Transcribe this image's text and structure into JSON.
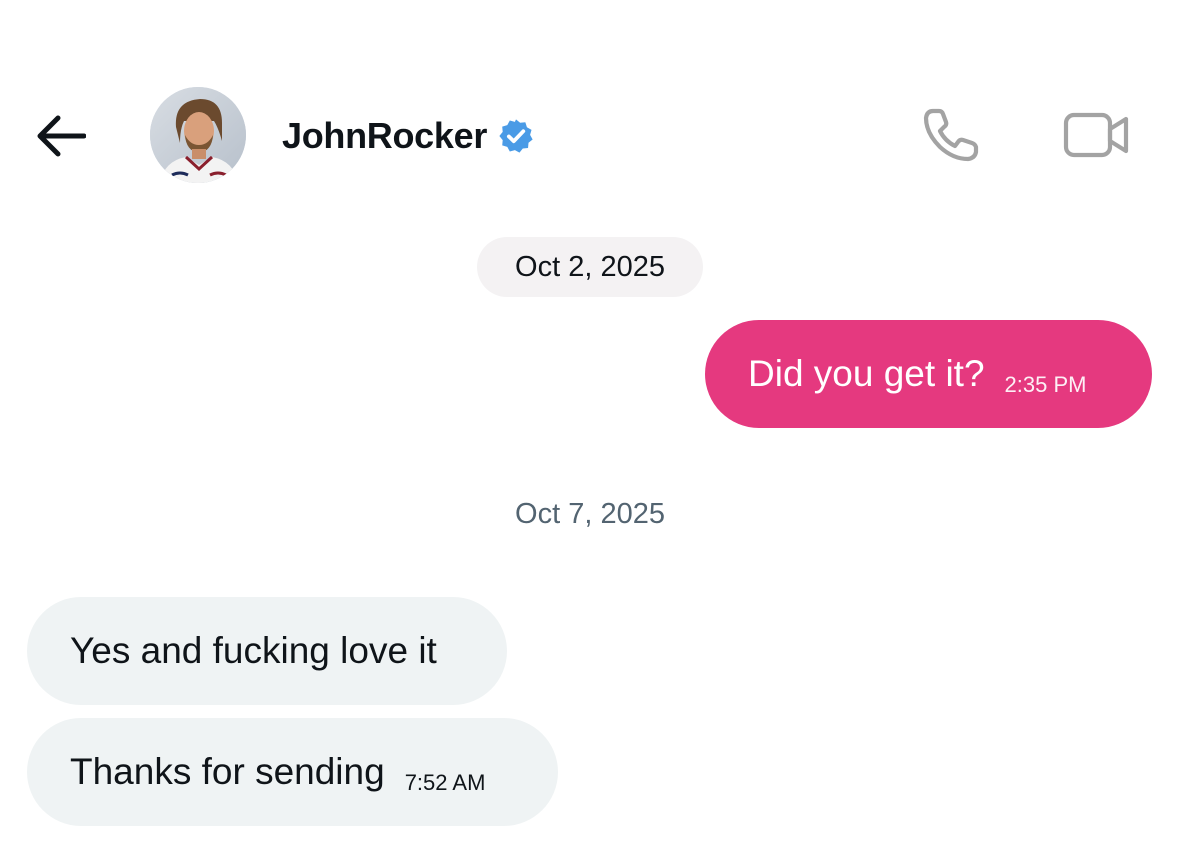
{
  "header": {
    "back_icon": "arrow-left-icon",
    "contact_name": "JohnRocker",
    "verified_badge_icon": "verified-badge-icon",
    "verified_color": "#1d9bf0",
    "call_icon": "phone-icon",
    "video_icon": "video-camera-icon"
  },
  "conversation": {
    "groups": [
      {
        "date": "Oct 2, 2025",
        "messages": [
          {
            "direction": "outgoing",
            "text": "Did you get it?",
            "time": "2:35 PM"
          }
        ]
      },
      {
        "date": "Oct 7, 2025",
        "messages": [
          {
            "direction": "incoming",
            "text": "Yes and fucking love it"
          },
          {
            "direction": "incoming",
            "text": "Thanks for sending",
            "time": "7:52 AM"
          }
        ]
      }
    ]
  },
  "colors": {
    "outgoing_bubble": "#e5397f",
    "incoming_bubble": "#eff3f4",
    "date_pill": "#f4f2f3",
    "secondary_text": "#536471"
  }
}
